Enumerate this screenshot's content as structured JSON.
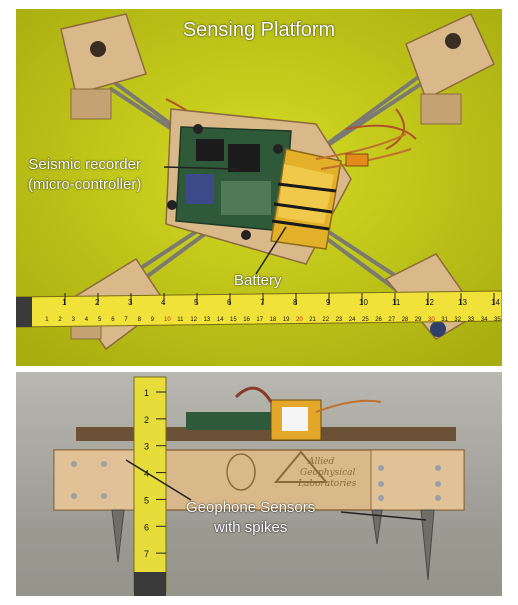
{
  "top_photo": {
    "title": "Sensing Platform",
    "callouts": {
      "seismic_recorder_line1": "Seismic recorder",
      "seismic_recorder_line2": "(micro-controller)",
      "battery": "Battery"
    },
    "ruler_inches": [
      "1",
      "2",
      "3",
      "4",
      "5",
      "6",
      "7",
      "8",
      "9",
      "10",
      "11",
      "12",
      "13",
      "14"
    ],
    "ruler_cm": [
      "1",
      "2",
      "3",
      "4",
      "5",
      "6",
      "7",
      "8",
      "9",
      "10",
      "11",
      "12",
      "13",
      "14",
      "15",
      "16",
      "17",
      "18",
      "19",
      "20",
      "21",
      "22",
      "23",
      "24",
      "25",
      "26",
      "27",
      "28",
      "29",
      "30",
      "31",
      "32",
      "33",
      "34",
      "35"
    ],
    "colors": {
      "background": "#c9cf1c",
      "wood": "#d9b98a",
      "pcb": "#2f5a3a",
      "battery": "#e3b02a",
      "tape": "#f1e23a"
    }
  },
  "bottom_photo": {
    "callouts": {
      "geophone_line1": "Geophone Sensors",
      "geophone_line2": "with spikes"
    },
    "engraving_lines": [
      "Allied",
      "Geophysical",
      "Laboratories"
    ],
    "tape_inches": [
      "1",
      "2",
      "3",
      "4",
      "5",
      "6",
      "7"
    ],
    "colors": {
      "background": "#a9a9a1",
      "wood": "#d9b98a",
      "tape": "#e6dc3a"
    }
  }
}
